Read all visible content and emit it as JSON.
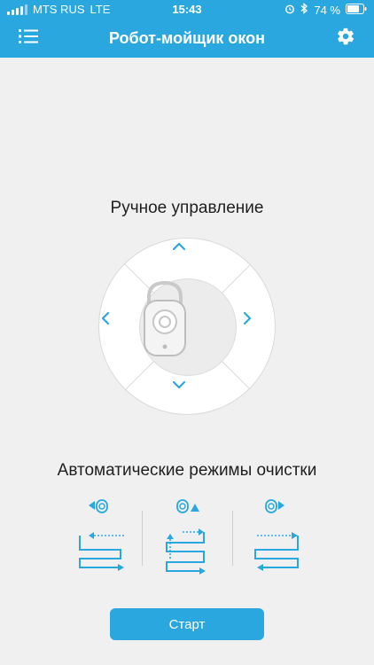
{
  "status": {
    "carrier": "MTS RUS",
    "network": "LTE",
    "time": "15:43",
    "battery": "74 %"
  },
  "header": {
    "title": "Робот-мойщик окон",
    "menu_icon": "hamburger-list-icon",
    "settings_icon": "gear-icon"
  },
  "manual": {
    "heading": "Ручное управление"
  },
  "auto": {
    "heading": "Автоматические режимы очистки",
    "modes": [
      {
        "name": "mode-left-start",
        "icon": "robot-left-arrow-icon"
      },
      {
        "name": "mode-up-start",
        "icon": "robot-up-arrow-icon"
      },
      {
        "name": "mode-right-start",
        "icon": "robot-right-arrow-icon"
      }
    ]
  },
  "start": {
    "label": "Старт"
  },
  "colors": {
    "accent": "#2ba7e0",
    "background": "#f0f0f0",
    "icon_blue": "#2ba7e0"
  }
}
